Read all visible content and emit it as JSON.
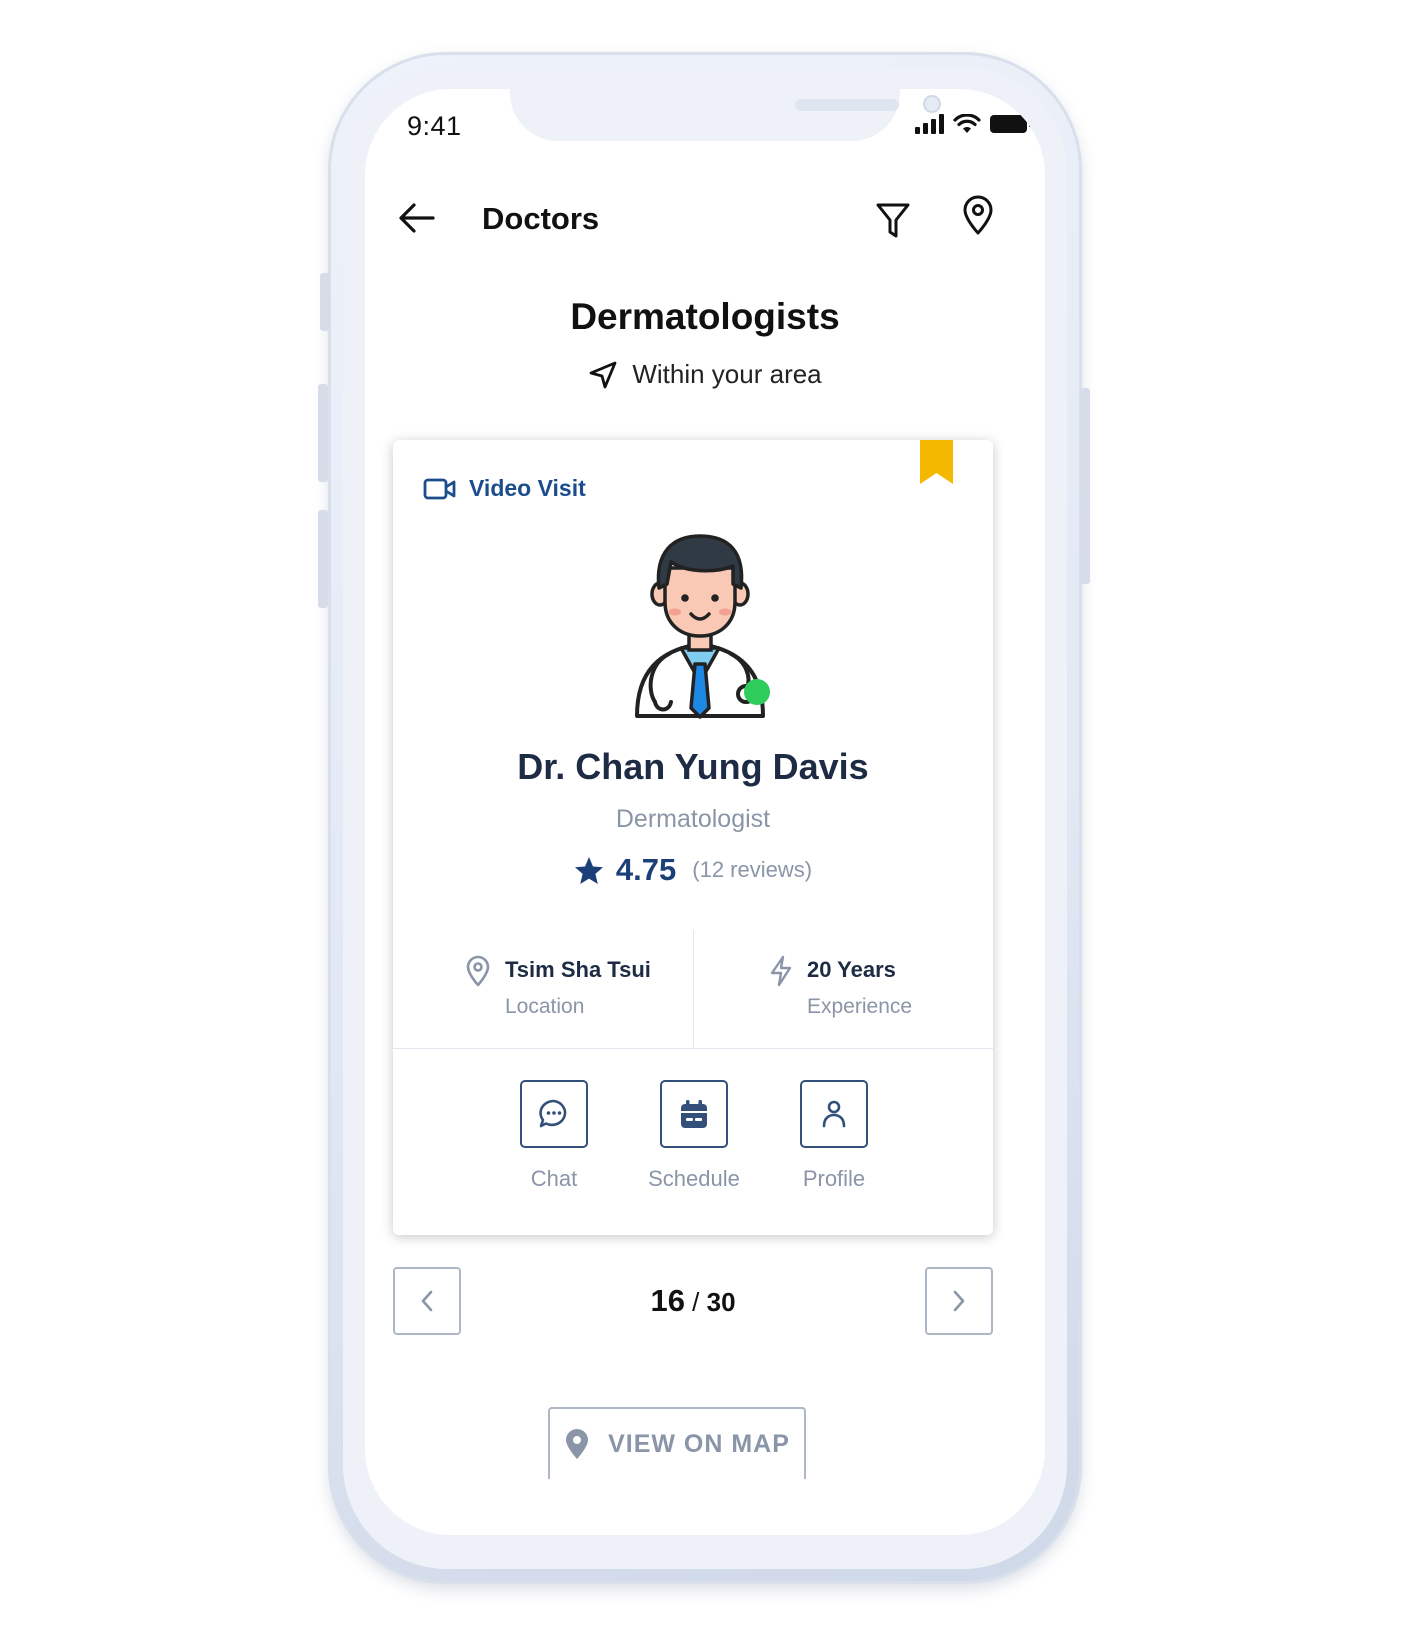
{
  "status_bar": {
    "time": "9:41",
    "icons": [
      "signal-icon",
      "wifi-icon",
      "battery-icon"
    ]
  },
  "nav": {
    "title": "Doctors",
    "icons": [
      "back-arrow-icon",
      "filter-icon",
      "map-pin-icon"
    ]
  },
  "header": {
    "title": "Dermatologists",
    "subtitle": "Within your area"
  },
  "doctor_card": {
    "visit_type": "Video Visit",
    "name": "Dr. Chan Yung Davis",
    "specialty": "Dermatologist",
    "rating": "4.75",
    "reviews": "(12 reviews)",
    "online": true,
    "bookmarked": true,
    "location": {
      "value": "Tsim Sha Tsui",
      "label": "Location"
    },
    "experience": {
      "value": "20 Years",
      "label": "Experience"
    },
    "actions": [
      {
        "label": "Chat",
        "icon": "chat-bubble-icon"
      },
      {
        "label": "Schedule",
        "icon": "calendar-icon"
      },
      {
        "label": "Profile",
        "icon": "user-icon"
      }
    ]
  },
  "pager": {
    "current": "16",
    "separator": " / ",
    "total": "30"
  },
  "map_button": {
    "label": "VIEW ON MAP"
  },
  "colors": {
    "primary": "#1b4d8c",
    "accent_bookmark": "#f5b800",
    "online": "#2ecc5a",
    "muted": "#8a95a8"
  }
}
